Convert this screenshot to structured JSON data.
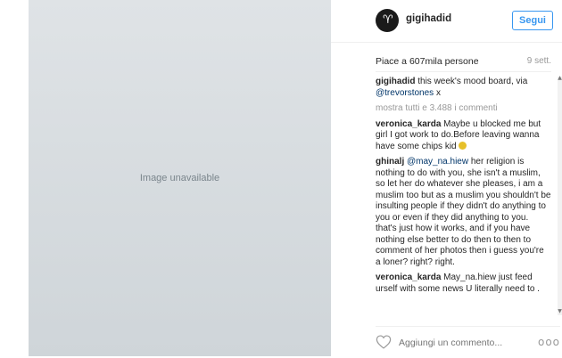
{
  "post": {
    "image_placeholder": "Image unavailable"
  },
  "header": {
    "username": "gigihadid",
    "follow_label": "Segui"
  },
  "likes": {
    "text": "Piace a 607mila persone",
    "time": "9 sett."
  },
  "caption": {
    "username": "gigihadid",
    "text": " this week's mood board, via ",
    "mention": "@trevorstones",
    "suffix": " x"
  },
  "show_all": "mostra tutti e 3.488 i commenti",
  "comments": [
    {
      "username": "veronica_karda",
      "text": " Maybe u blocked me but girl I got work to do.Before leaving wanna have some chips kid"
    },
    {
      "username": "ghinalj",
      "mention": " @may_na.hiew",
      "text": " her religion is nothing to do with you, she isn't a muslim, so let her do whatever she pleases, i am a muslim too but as a muslim you shouldn't be insulting people if they didn't do anything to you or even if they did anything to you. that's just how it works, and if you have nothing else better to do then to then to comment of her photos then i guess you're a loner? right? right."
    },
    {
      "username": "veronica_karda",
      "text": " May_na.hiew just feed urself with some news U literally need to ."
    }
  ],
  "footer": {
    "add_comment_placeholder": "Aggiungi un commento...",
    "more_label": "ooo"
  },
  "colors": {
    "accent": "#3897f0",
    "link": "#003569",
    "muted": "#999999"
  },
  "icons": [
    "avatar-logo-icon",
    "heart-icon",
    "more-options-icon",
    "scroll-up-icon",
    "scroll-down-icon",
    "emoji-icon"
  ]
}
